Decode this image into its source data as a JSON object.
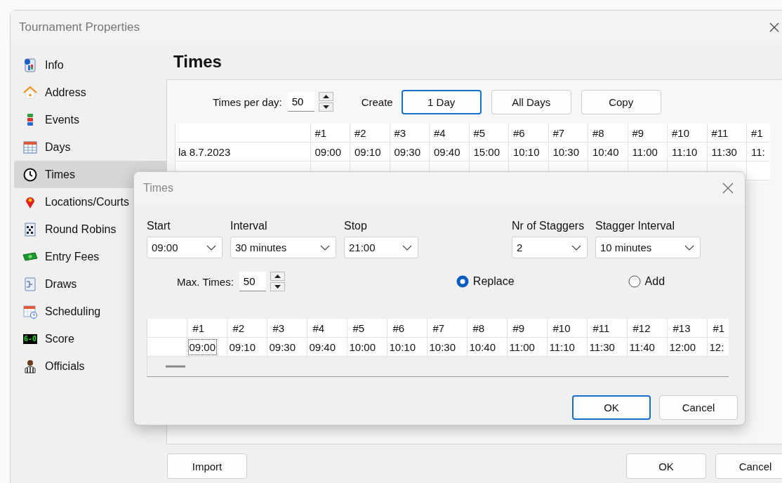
{
  "window": {
    "title": "Tournament Properties"
  },
  "sidebar": {
    "items": [
      {
        "label": "Info",
        "selected": false
      },
      {
        "label": "Address",
        "selected": false
      },
      {
        "label": "Events",
        "selected": false
      },
      {
        "label": "Days",
        "selected": false
      },
      {
        "label": "Times",
        "selected": true
      },
      {
        "label": "Locations/Courts",
        "selected": false
      },
      {
        "label": "Round Robins",
        "selected": false
      },
      {
        "label": "Entry Fees",
        "selected": false
      },
      {
        "label": "Draws",
        "selected": false
      },
      {
        "label": "Scheduling",
        "selected": false
      },
      {
        "label": "Score",
        "selected": false,
        "badge": "6-0"
      },
      {
        "label": "Officials",
        "selected": false
      }
    ]
  },
  "page": {
    "heading": "Times",
    "times_per_day": {
      "label": "Times per day:",
      "value": "50"
    },
    "create_label": "Create",
    "create_buttons": [
      {
        "label": "1 Day",
        "focused": true
      },
      {
        "label": "All Days",
        "focused": false
      },
      {
        "label": "Copy",
        "focused": false
      }
    ],
    "table": {
      "columns": [
        "#1",
        "#2",
        "#3",
        "#4",
        "#5",
        "#6",
        "#7",
        "#8",
        "#9",
        "#10",
        "#11",
        "#1"
      ],
      "rows": [
        {
          "day": "la 8.7.2023",
          "cells": [
            "09:00",
            "09:10",
            "09:30",
            "09:40",
            "15:00",
            "10:10",
            "10:30",
            "10:40",
            "11:00",
            "11:10",
            "11:30",
            "11:"
          ]
        }
      ]
    }
  },
  "dialog": {
    "title": "Times",
    "fields": [
      {
        "label": "Start",
        "value": "09:00"
      },
      {
        "label": "Interval",
        "value": "30 minutes"
      },
      {
        "label": "Stop",
        "value": "21:00"
      },
      {
        "label": "Nr of Staggers",
        "value": "2"
      },
      {
        "label": "Stagger Interval",
        "value": "10 minutes"
      }
    ],
    "max_times": {
      "label": "Max. Times:",
      "value": "50"
    },
    "radios": [
      {
        "label": "Replace",
        "selected": true
      },
      {
        "label": "Add",
        "selected": false
      }
    ],
    "table": {
      "columns": [
        "#1",
        "#2",
        "#3",
        "#4",
        "#5",
        "#6",
        "#7",
        "#8",
        "#9",
        "#10",
        "#11",
        "#12",
        "#13",
        "#1"
      ],
      "rows": [
        {
          "cells": [
            {
              "text": "09:00",
              "focused": true
            },
            {
              "text": "09:10",
              "focused": false
            },
            {
              "text": "09:30",
              "focused": false
            },
            {
              "text": "09:40",
              "focused": false
            },
            {
              "text": "10:00",
              "focused": false
            },
            {
              "text": "10:10",
              "focused": false
            },
            {
              "text": "10:30",
              "focused": false
            },
            {
              "text": "10:40",
              "focused": false
            },
            {
              "text": "11:00",
              "focused": false
            },
            {
              "text": "11:10",
              "focused": false
            },
            {
              "text": "11:30",
              "focused": false
            },
            {
              "text": "11:40",
              "focused": false
            },
            {
              "text": "12:00",
              "focused": false
            },
            {
              "text": "12:",
              "focused": false
            }
          ]
        }
      ]
    },
    "buttons": [
      {
        "label": "OK",
        "default": true
      },
      {
        "label": "Cancel",
        "default": false
      }
    ]
  },
  "footer": {
    "left_buttons": [
      {
        "label": "Import"
      }
    ],
    "right_buttons": [
      {
        "label": "OK"
      },
      {
        "label": "Cancel"
      }
    ]
  }
}
